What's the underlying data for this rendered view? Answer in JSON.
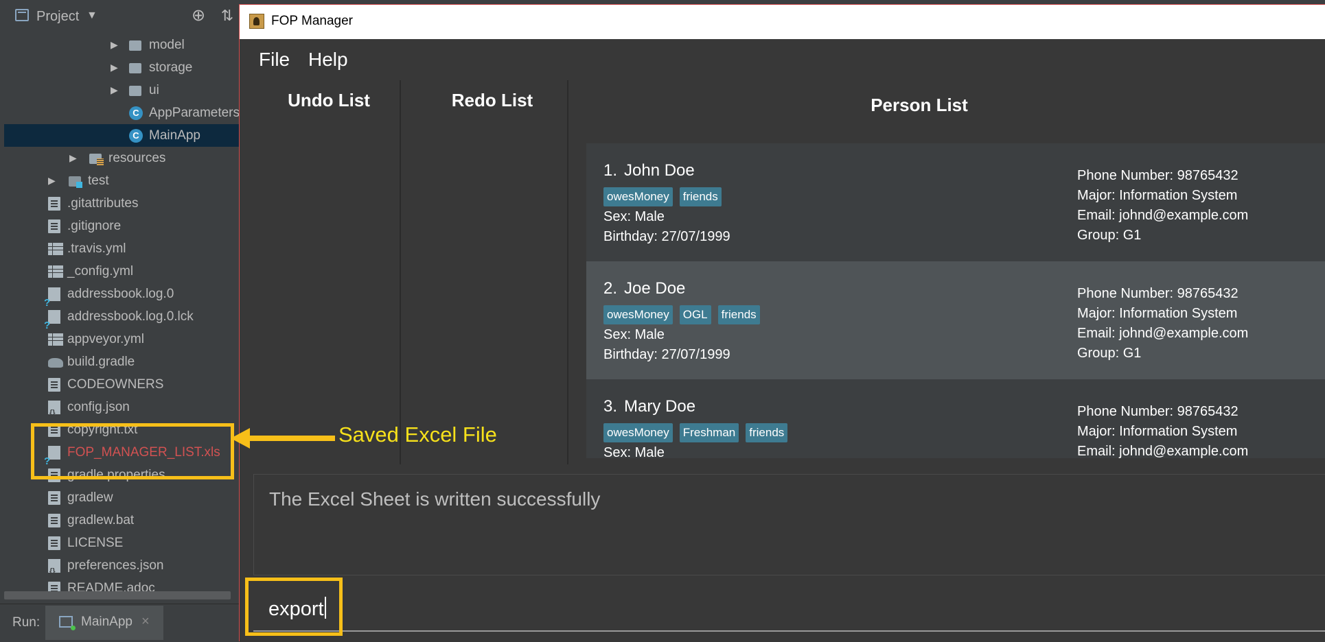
{
  "ide": {
    "panel_title": "Project",
    "tree": [
      {
        "label": "model",
        "icon": "folder-icon",
        "arrow": true
      },
      {
        "label": "storage",
        "icon": "folder-icon",
        "arrow": true
      },
      {
        "label": "ui",
        "icon": "folder-icon",
        "arrow": true
      },
      {
        "label": "AppParameters",
        "icon": "class-icon",
        "arrow": false
      },
      {
        "label": "MainApp",
        "icon": "class-icon",
        "arrow": false,
        "selected": true
      },
      {
        "label": "resources",
        "icon": "resources-folder-icon",
        "arrow": true
      },
      {
        "label": "test",
        "icon": "test-folder-icon",
        "arrow": true
      },
      {
        "label": ".gitattributes",
        "icon": "file-icon"
      },
      {
        "label": ".gitignore",
        "icon": "file-icon"
      },
      {
        "label": ".travis.yml",
        "icon": "table-file-icon"
      },
      {
        "label": "_config.yml",
        "icon": "table-file-icon"
      },
      {
        "label": "addressbook.log.0",
        "icon": "unknown-file-icon"
      },
      {
        "label": "addressbook.log.0.lck",
        "icon": "unknown-file-icon"
      },
      {
        "label": "appveyor.yml",
        "icon": "table-file-icon"
      },
      {
        "label": "build.gradle",
        "icon": "gradle-icon"
      },
      {
        "label": "CODEOWNERS",
        "icon": "file-icon"
      },
      {
        "label": "config.json",
        "icon": "json-file-icon"
      },
      {
        "label": "copyright.txt",
        "icon": "file-icon"
      },
      {
        "label": "FOP_MANAGER_LIST.xls",
        "icon": "unknown-file-icon",
        "highlight": true
      },
      {
        "label": "gradle.properties",
        "icon": "file-icon"
      },
      {
        "label": "gradlew",
        "icon": "file-icon"
      },
      {
        "label": "gradlew.bat",
        "icon": "file-icon"
      },
      {
        "label": "LICENSE",
        "icon": "file-icon"
      },
      {
        "label": "preferences.json",
        "icon": "json-file-icon"
      },
      {
        "label": "README.adoc",
        "icon": "file-icon"
      }
    ],
    "run_label": "Run:",
    "run_tab": "MainApp",
    "run_tab_close": "×"
  },
  "app": {
    "window_title": "FOP Manager",
    "menu": {
      "file": "File",
      "help": "Help"
    },
    "undo_title": "Undo List",
    "redo_title": "Redo List",
    "person_title": "Person List",
    "persons": [
      {
        "index": "1.",
        "name": "John Doe",
        "tags": [
          "owesMoney",
          "friends"
        ],
        "sex": "Sex: Male",
        "birthday": "Birthday: 27/07/1999",
        "phone": "Phone Number: 98765432",
        "major": "Major: Information System",
        "email": "Email: johnd@example.com",
        "group": "Group: G1"
      },
      {
        "index": "2.",
        "name": "Joe Doe",
        "tags": [
          "owesMoney",
          "OGL",
          "friends"
        ],
        "sex": "Sex: Male",
        "birthday": "Birthday: 27/07/1999",
        "phone": "Phone Number: 98765432",
        "major": "Major: Information System",
        "email": "Email: johnd@example.com",
        "group": "Group: G1"
      },
      {
        "index": "3.",
        "name": "Mary Doe",
        "tags": [
          "owesMoney",
          "Freshman",
          "friends"
        ],
        "sex": "Sex: Male",
        "phone": "Phone Number: 98765432",
        "major": "Major: Information System",
        "email": "Email: johnd@example.com"
      }
    ],
    "result_message": "The Excel Sheet is written successfully",
    "command_input": "export"
  },
  "annotation": {
    "label": "Saved Excel File",
    "color": "#f7bf19",
    "text_color": "#f7e11b"
  },
  "colors": {
    "ide_bg": "#3c3f41",
    "app_bg": "#383838",
    "tag_bg": "#3e7b91",
    "selected_row": "#0d293e",
    "card_alt": "#4f5457",
    "modified_file": "#d25252"
  }
}
